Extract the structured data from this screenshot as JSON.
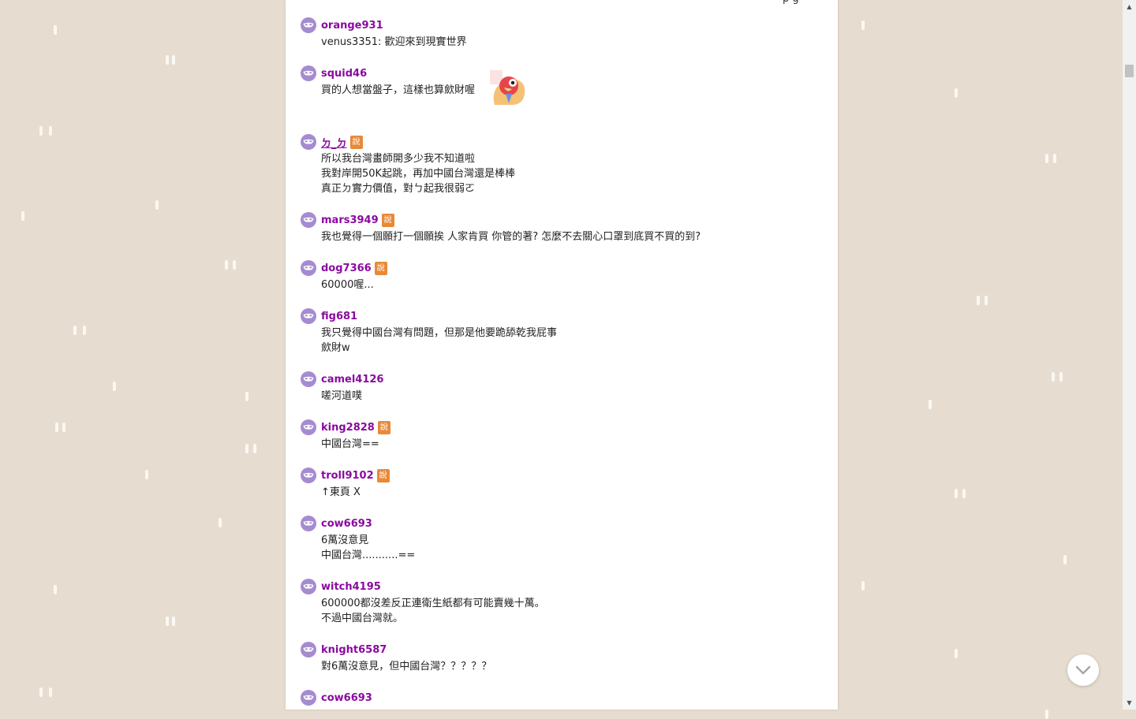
{
  "top_cut_text": "p g",
  "comments": [
    {
      "user": "orange931",
      "badge": "",
      "lines": [
        "venus3351: 歡迎來到現實世界"
      ]
    },
    {
      "user": "squid46",
      "badge": "",
      "lines": [
        "買的人想當盤子，這樣也算歛財喔"
      ],
      "sticker": "parrot-sticker"
    },
    {
      "user": "ㄉ_ㄉ",
      "badge": "說",
      "lines": [
        "所以我台灣畫師開多少我不知道啦",
        "我對岸開50K起跳，再加中國台灣還是棒棒",
        "真正ㄉ實力價值，對ㄅ起我很弱ㄛ"
      ]
    },
    {
      "user": "mars3949",
      "badge": "說",
      "lines": [
        "我也覺得一個願打一個願挨 人家肯買 你管的著? 怎麼不去關心口罩到底買不買的到?"
      ]
    },
    {
      "user": "dog7366",
      "badge": "說",
      "lines": [
        "60000喔..."
      ]
    },
    {
      "user": "fig681",
      "badge": "",
      "lines": [
        "我只覺得中國台灣有問題，但那是他要跪舔乾我屁事",
        "歛財w"
      ]
    },
    {
      "user": "camel4126",
      "badge": "",
      "lines": [
        "嗟河道噗"
      ]
    },
    {
      "user": "king2828",
      "badge": "說",
      "lines": [
        "中國台灣=="
      ]
    },
    {
      "user": "troll9102",
      "badge": "說",
      "lines": [
        "↑東頁 X"
      ]
    },
    {
      "user": "cow6693",
      "badge": "",
      "lines": [
        "6萬沒意見",
        "中國台灣...........=="
      ]
    },
    {
      "user": "witch4195",
      "badge": "",
      "lines": [
        "600000都沒差反正連衛生紙都有可能賣幾十萬。",
        "不過中國台灣就。"
      ]
    },
    {
      "user": "knight6587",
      "badge": "",
      "lines": [
        "對6萬沒意見，但中國台灣？？？？？"
      ]
    },
    {
      "user": "cow6693",
      "badge": "",
      "lines": []
    }
  ],
  "colors": {
    "background": "#e6ddd0",
    "username": "#8a0a9f",
    "avatar": "#a58bd0",
    "badge": "#e8893a"
  },
  "icons": {
    "avatar": "mask-avatar-icon",
    "scroll": "chevron-down-icon"
  }
}
